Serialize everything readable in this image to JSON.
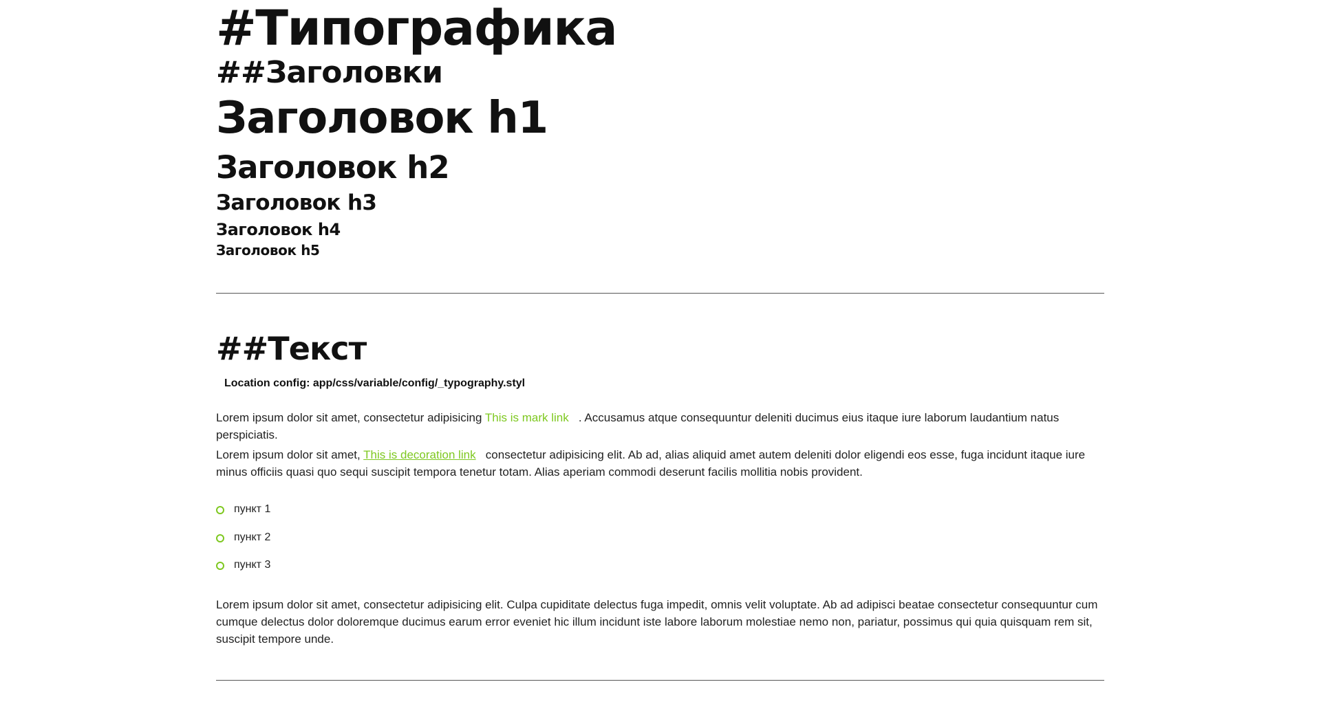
{
  "title": "#Типографика",
  "headings_section": {
    "title": "##Заголовки",
    "h1": "Заголовок h1",
    "h2": "Заголовок h2",
    "h3": "Заголовок h3",
    "h4": "Заголовок h4",
    "h5": "Заголовок h5"
  },
  "text_section": {
    "title": "##Текст",
    "location": "Location config: app/css/variable/config/_typography.styl",
    "p1_before": "Lorem ipsum dolor sit amet, consectetur adipisicing ",
    "p1_link": "This is mark link",
    "p1_after": "   . Accusamus atque consequuntur deleniti ducimus eius itaque iure laborum laudantium natus perspiciatis.",
    "p2_before": "Lorem ipsum dolor sit amet, ",
    "p2_link": "This is decoration link",
    "p2_after": "   consectetur adipisicing elit. Ab ad, alias aliquid amet autem deleniti dolor eligendi eos esse, fuga incidunt itaque iure minus officiis quasi quo sequi suscipit tempora tenetur totam. Alias aperiam commodi deserunt facilis mollitia nobis provident.",
    "list": [
      "пункт 1",
      "пункт 2",
      "пункт 3"
    ],
    "p3": "Lorem ipsum dolor sit amet, consectetur adipisicing elit. Culpa cupiditate delectus fuga impedit, omnis velit voluptate. Ab ad adipisci beatae consectetur consequuntur cum cumque delectus dolor doloremque ducimus earum error eveniet hic illum incidunt iste labore laborum molestiae nemo non, pariatur, possimus qui quia quisquam rem sit, suscipit tempore unde."
  },
  "colors": {
    "accent": "#7ec820",
    "text": "#111111"
  }
}
